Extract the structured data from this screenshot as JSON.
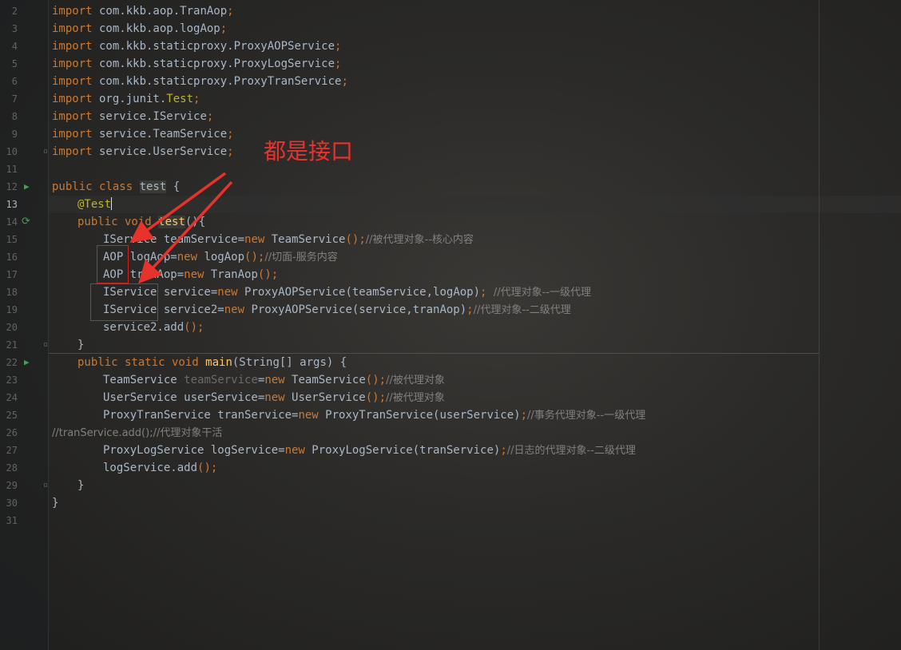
{
  "editor": {
    "line_numbers": [
      "2",
      "3",
      "4",
      "5",
      "6",
      "7",
      "8",
      "9",
      "10",
      "11",
      "12",
      "13",
      "14",
      "15",
      "16",
      "17",
      "18",
      "19",
      "20",
      "21",
      "22",
      "23",
      "24",
      "25",
      "26",
      "27",
      "28",
      "29",
      "30",
      "31"
    ],
    "current_line": "13"
  },
  "code": {
    "l2": {
      "kw": "import",
      "rest": " com.kkb.aop.TranAop",
      "semi": ";"
    },
    "l3": {
      "kw": "import",
      "rest": " com.kkb.aop.logAop",
      "semi": ";"
    },
    "l4": {
      "kw": "import",
      "rest": " com.kkb.staticproxy.ProxyAOPService",
      "semi": ";"
    },
    "l5": {
      "kw": "import",
      "rest": " com.kkb.staticproxy.ProxyLogService",
      "semi": ";"
    },
    "l6": {
      "kw": "import",
      "rest": " com.kkb.staticproxy.ProxyTranService",
      "semi": ";"
    },
    "l7": {
      "kw": "import",
      "rest": " org.junit.",
      "ann": "Test",
      "semi": ";"
    },
    "l8": {
      "kw": "import",
      "rest": " service.IService",
      "semi": ";"
    },
    "l9": {
      "kw": "import",
      "rest": " service.TeamService",
      "semi": ";"
    },
    "l10": {
      "kw": "import",
      "rest": " service.UserService",
      "semi": ";"
    },
    "l12": {
      "kw": "public class ",
      "name": "test",
      "rest": " {"
    },
    "l13": {
      "ann": "@Test"
    },
    "l14": {
      "kw": "public void ",
      "name": "test",
      "rest": "(){"
    },
    "l15": {
      "a": "IService teamService=",
      "kw": "new",
      "b": " TeamService",
      "c": "();",
      "cm": "//被代理对象--核心内容"
    },
    "l16": {
      "a": "AOP logAop=",
      "kw": "new",
      "b": " logAop",
      "c": "();",
      "cm": "//切面-服务内容"
    },
    "l17": {
      "a": "AOP tranAop=",
      "kw": "new",
      "b": " TranAop",
      "c": "();"
    },
    "l18": {
      "a": "IService service=",
      "kw": "new",
      "b": " ProxyAOPService(teamService,logAop)",
      "c": "; ",
      "cm": "//代理对象--一级代理"
    },
    "l19": {
      "a": "IService service2=",
      "kw": "new",
      "b": " ProxyAOPService(service,tranAop)",
      "c": ";",
      "cm": "//代理对象--二级代理"
    },
    "l20": {
      "a": "service2.add",
      "c": "();"
    },
    "l21": {
      "a": "}"
    },
    "l22": {
      "kw": "public static void ",
      "name": "main",
      "rest": "(String[] args) {"
    },
    "l23": {
      "a": "TeamService ",
      "g": "teamService",
      "b": "=",
      "kw": "new",
      "b2": " TeamService",
      "c": "();",
      "cm": "//被代理对象"
    },
    "l24": {
      "a": "UserService userService=",
      "kw": "new",
      "b": " UserService",
      "c": "();",
      "cm": "//被代理对象"
    },
    "l25": {
      "a": "ProxyTranService tranService=",
      "kw": "new",
      "b": " ProxyTranService(userService)",
      "c": ";",
      "cm": "//事务代理对象--一级代理"
    },
    "l26": {
      "cm": "//tranService.add();//代理对象干活"
    },
    "l27": {
      "a": "ProxyLogService logService=",
      "kw": "new",
      "b": " ProxyLogService(tranService)",
      "c": ";",
      "cm": "//日志的代理对象--二级代理"
    },
    "l28": {
      "a": "logService.add",
      "c": "();"
    },
    "l29": {
      "a": "}"
    },
    "l30": {
      "a": "}"
    }
  },
  "annotation": {
    "text": "都是接口",
    "color": "#e8322c"
  }
}
